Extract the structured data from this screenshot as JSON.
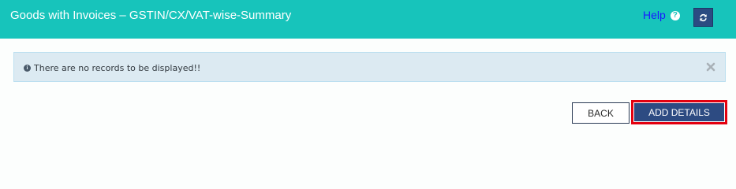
{
  "header": {
    "title": "Goods with Invoices – GSTIN/CX/VAT-wise-Summary",
    "help_label": "Help",
    "help_icon": "?",
    "refresh_icon": "refresh-icon",
    "background_color": "#17c4bb"
  },
  "alert": {
    "icon": "i",
    "message": "There are no records to be displayed!!",
    "close_icon": "close-icon"
  },
  "actions": {
    "back_label": "BACK",
    "add_details_label": "ADD DETAILS",
    "primary_color": "#2d4b82",
    "highlight_color": "#e3000f"
  }
}
